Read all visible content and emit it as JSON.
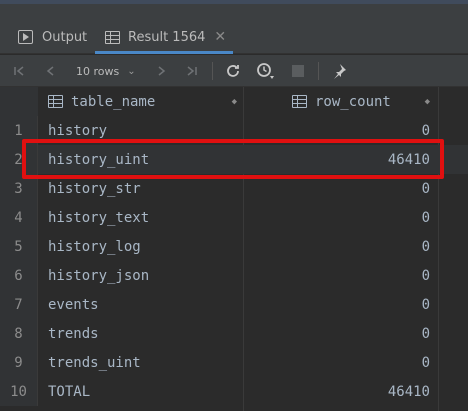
{
  "tabs": {
    "output_label": "Output",
    "result_label": "Result 1564",
    "close_glyph": "✕"
  },
  "toolbar": {
    "rows_label": "10 rows",
    "caret": "⌄"
  },
  "table": {
    "columns": [
      "table_name",
      "row_count"
    ],
    "rows": [
      {
        "n": "1",
        "name": "history",
        "count": "0"
      },
      {
        "n": "2",
        "name": "history_uint",
        "count": "46410"
      },
      {
        "n": "3",
        "name": "history_str",
        "count": "0"
      },
      {
        "n": "4",
        "name": "history_text",
        "count": "0"
      },
      {
        "n": "5",
        "name": "history_log",
        "count": "0"
      },
      {
        "n": "6",
        "name": "history_json",
        "count": "0"
      },
      {
        "n": "7",
        "name": "events",
        "count": "0"
      },
      {
        "n": "8",
        "name": "trends",
        "count": "0"
      },
      {
        "n": "9",
        "name": "trends_uint",
        "count": "0"
      },
      {
        "n": "10",
        "name": "TOTAL",
        "count": "46410"
      }
    ]
  },
  "highlight": {
    "color": "#e01010",
    "row": "2"
  },
  "icons": [
    "run-icon",
    "table-grid-icon",
    "close-icon",
    "first-page-icon",
    "prev-page-icon",
    "next-page-icon",
    "last-page-icon",
    "refresh-icon",
    "history-icon",
    "stop-icon",
    "pin-icon",
    "column-icon",
    "sort-icon"
  ]
}
